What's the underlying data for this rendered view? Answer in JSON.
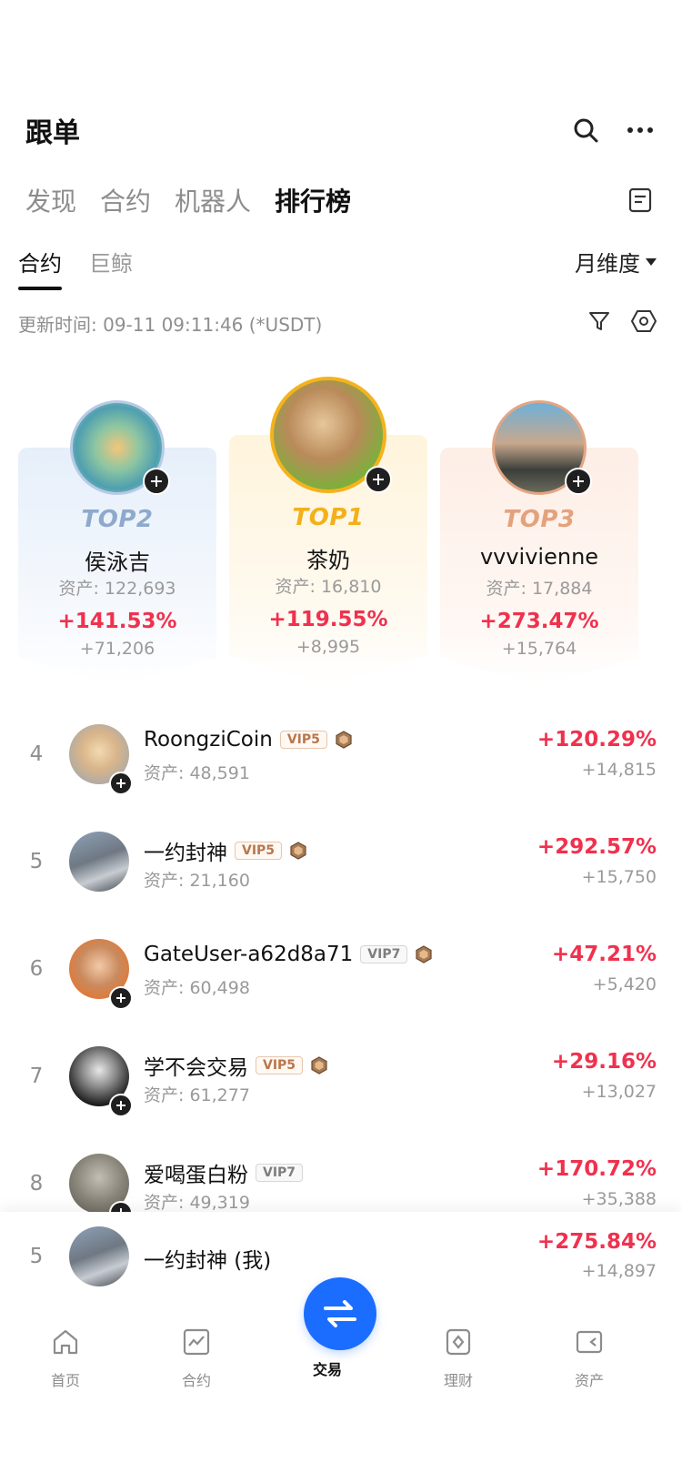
{
  "header": {
    "title": "跟单"
  },
  "main_tabs": [
    "发现",
    "合约",
    "机器人",
    "排行榜"
  ],
  "sub_tabs": [
    "合约",
    "巨鲸"
  ],
  "period_label": "月维度",
  "update_text": "更新时间: 09-11 09:11:46 (*USDT)",
  "top3": [
    {
      "rank": "TOP2",
      "name": "侯泳吉",
      "asset": "资产: 122,693",
      "pct": "+141.53%",
      "profit": "+71,206",
      "color": "#8ea9cc"
    },
    {
      "rank": "TOP1",
      "name": "茶奶",
      "asset": "资产: 16,810",
      "pct": "+119.55%",
      "profit": "+8,995",
      "color": "#f2b01a"
    },
    {
      "rank": "TOP3",
      "name": "vvvivienne",
      "asset": "资产: 17,884",
      "pct": "+273.47%",
      "profit": "+15,764",
      "color": "#e4a27c"
    }
  ],
  "list": [
    {
      "rank": "4",
      "name": "RoongziCoin",
      "vip": "VIP5",
      "medal": true,
      "asset": "资产: 48,591",
      "pct": "+120.29%",
      "profit": "+14,815"
    },
    {
      "rank": "5",
      "name": "一约封神",
      "vip": "VIP5",
      "medal": true,
      "asset": "资产: 21,160",
      "pct": "+292.57%",
      "profit": "+15,750"
    },
    {
      "rank": "6",
      "name": "GateUser-a62d8a71",
      "vip": "VIP7",
      "medal": true,
      "asset": "资产: 60,498",
      "pct": "+47.21%",
      "profit": "+5,420"
    },
    {
      "rank": "7",
      "name": "学不会交易",
      "vip": "VIP5",
      "medal": true,
      "asset": "资产: 61,277",
      "pct": "+29.16%",
      "profit": "+13,027"
    },
    {
      "rank": "8",
      "name": "爱喝蛋白粉",
      "vip": "VIP7",
      "medal": false,
      "asset": "资产: 49,319",
      "pct": "+170.72%",
      "profit": "+35,388"
    }
  ],
  "my_rank": {
    "rank": "5",
    "name": "一约封神 (我)",
    "pct": "+275.84%",
    "profit": "+14,897"
  },
  "tabbar": [
    "首页",
    "合约",
    "交易",
    "理财",
    "资产"
  ],
  "colors": {
    "up": "#f0314e",
    "accent": "#1a6dff",
    "gold": "#f2b01a"
  }
}
